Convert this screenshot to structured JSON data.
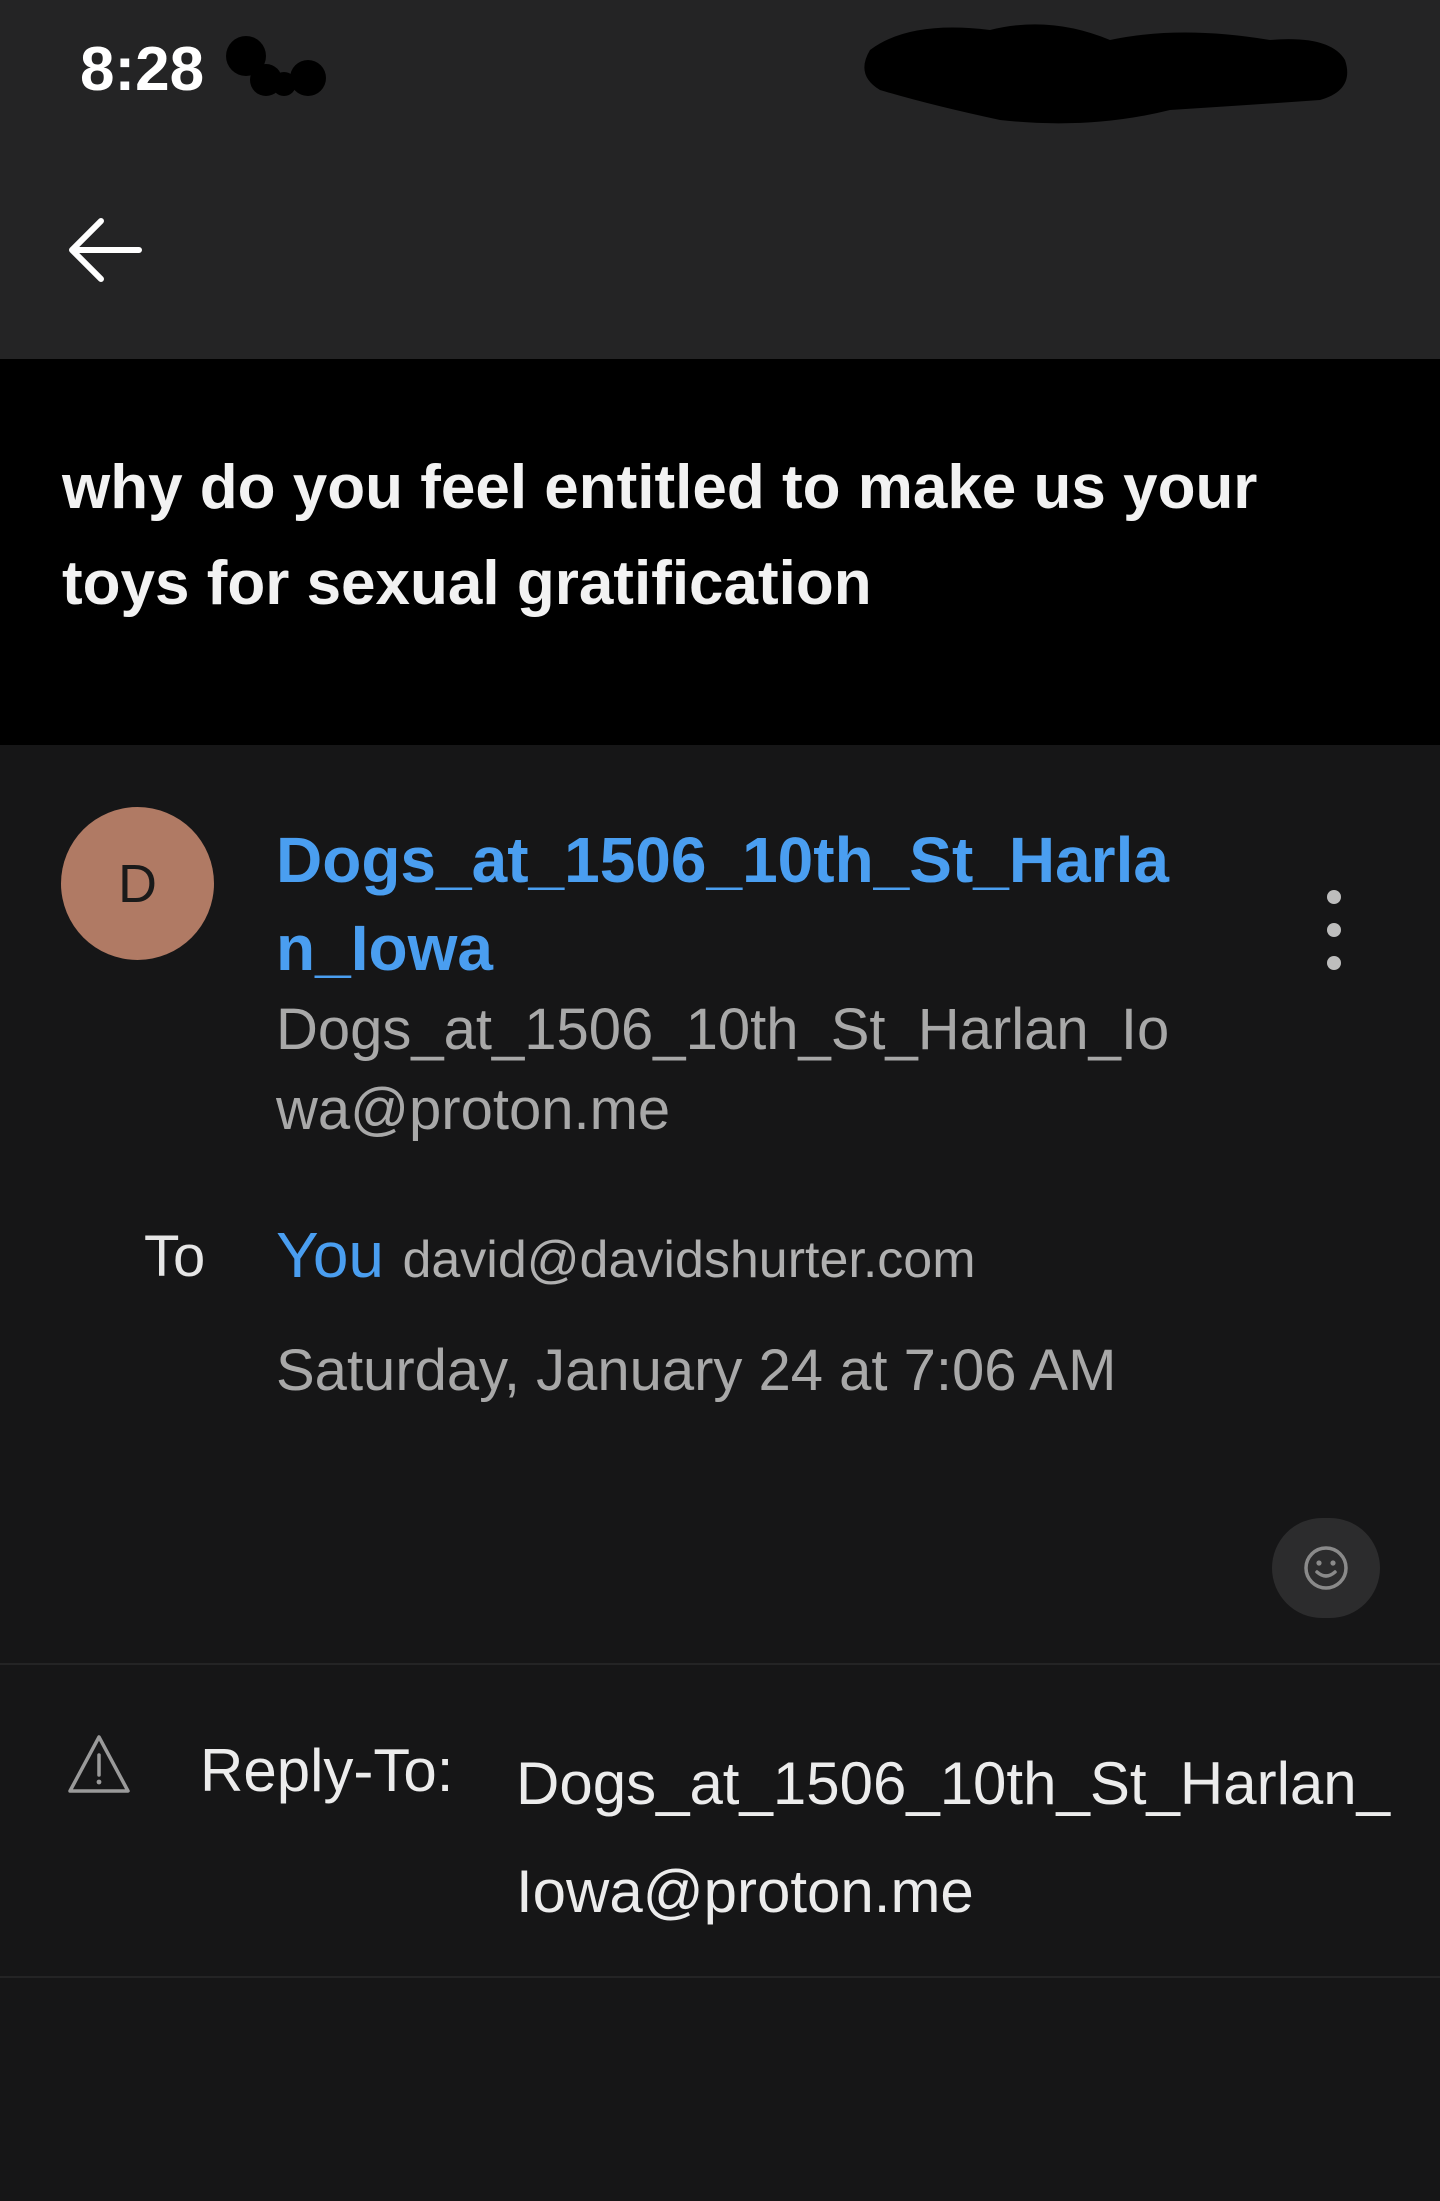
{
  "status_bar": {
    "time": "8:28"
  },
  "toolbar": {
    "back_icon": "arrow-left-icon"
  },
  "message": {
    "subject": "why do you feel entitled to make us your toys for sexual gratification",
    "sender": {
      "avatar_letter": "D",
      "avatar_color": "#b07a64",
      "name": "Dogs_at_1506_10th_St_Harlan_Iowa",
      "email": "Dogs_at_1506_10th_St_Harlan_Iowa@proton.me"
    },
    "to_label": "To",
    "recipient_name": "You",
    "recipient_email": "david@davidshurter.com",
    "date": "Saturday, January 24 at 7:06 AM",
    "reply_to_label": "Reply-To:",
    "reply_to_value": "Dogs_at_1506_10th_St_Harlan_Iowa@proton.me"
  },
  "colors": {
    "accent": "#4a9ef0",
    "background": "#161617",
    "top_bar": "#242425",
    "subject_bg": "#000000"
  },
  "icons": {
    "more": "more-vertical-icon",
    "reaction": "emoji-smile-icon",
    "warning": "warning-triangle-icon"
  }
}
